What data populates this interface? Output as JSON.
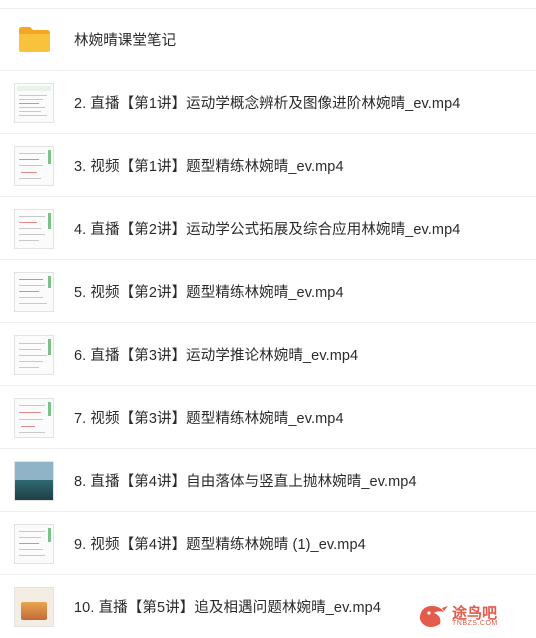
{
  "files": [
    {
      "name": "林婉晴课堂笔记",
      "type": "folder"
    },
    {
      "name": "2. 直播【第1讲】运动学概念辨析及图像进阶林婉晴_ev.mp4",
      "type": "video"
    },
    {
      "name": "3. 视频【第1讲】题型精练林婉晴_ev.mp4",
      "type": "video"
    },
    {
      "name": "4. 直播【第2讲】运动学公式拓展及综合应用林婉晴_ev.mp4",
      "type": "video"
    },
    {
      "name": "5. 视频【第2讲】题型精练林婉晴_ev.mp4",
      "type": "video"
    },
    {
      "name": "6. 直播【第3讲】运动学推论林婉晴_ev.mp4",
      "type": "video"
    },
    {
      "name": "7. 视频【第3讲】题型精练林婉晴_ev.mp4",
      "type": "video"
    },
    {
      "name": "8. 直播【第4讲】自由落体与竖直上抛林婉晴_ev.mp4",
      "type": "video"
    },
    {
      "name": "9. 视频【第4讲】题型精练林婉晴 (1)_ev.mp4",
      "type": "video"
    },
    {
      "name": "10. 直播【第5讲】追及相遇问题林婉晴_ev.mp4",
      "type": "video"
    }
  ],
  "watermark": {
    "title": "途鸟吧",
    "subtitle": "TNBZS.COM"
  },
  "colors": {
    "folder": "#f7b928",
    "watermark": "#e25b4b"
  }
}
